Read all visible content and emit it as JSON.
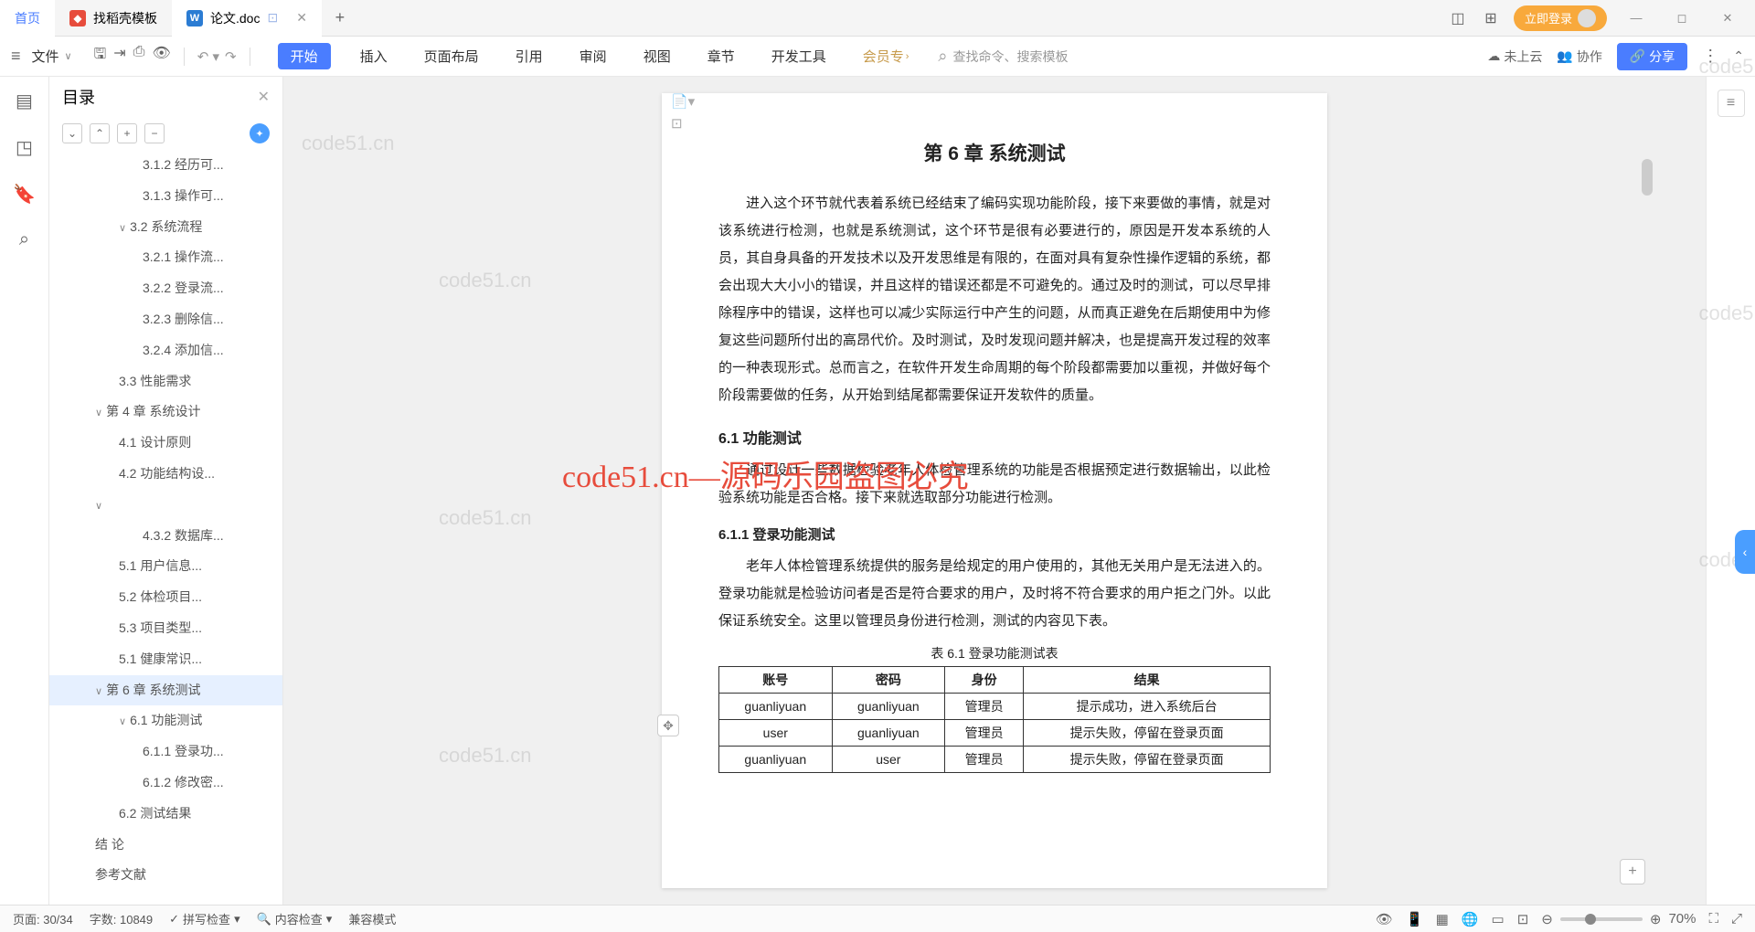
{
  "tabs": {
    "home": "首页",
    "template": "找稻壳模板",
    "doc": "论文.doc"
  },
  "login": "立即登录",
  "fileMenu": "文件",
  "ribbon": {
    "start": "开始",
    "insert": "插入",
    "layout": "页面布局",
    "reference": "引用",
    "review": "审阅",
    "view": "视图",
    "section": "章节",
    "devtools": "开发工具",
    "vip": "会员专"
  },
  "searchPlaceholder": "查找命令、搜索模板",
  "cloud": "未上云",
  "collab": "协作",
  "share": "分享",
  "outlineTitle": "目录",
  "outline": [
    {
      "t": "3.1.2 经历可...",
      "cls": "indent-4"
    },
    {
      "t": "3.1.3 操作可...",
      "cls": "indent-4"
    },
    {
      "t": "3.2 系统流程",
      "cls": "indent-3",
      "chev": "∨"
    },
    {
      "t": "3.2.1 操作流...",
      "cls": "indent-4"
    },
    {
      "t": "3.2.2 登录流...",
      "cls": "indent-4"
    },
    {
      "t": "3.2.3 删除信...",
      "cls": "indent-4"
    },
    {
      "t": "3.2.4 添加信...",
      "cls": "indent-4"
    },
    {
      "t": "3.3 性能需求",
      "cls": "indent-3"
    },
    {
      "t": "第 4 章  系统设计",
      "cls": "indent-2",
      "chev": "∨"
    },
    {
      "t": "4.1 设计原则",
      "cls": "indent-3"
    },
    {
      "t": "4.2 功能结构设...",
      "cls": "indent-3"
    },
    {
      "t": "",
      "cls": "indent-2",
      "chev": "∨"
    },
    {
      "t": "4.3.2 数据库...",
      "cls": "indent-4"
    },
    {
      "t": "5.1 用户信息...",
      "cls": "indent-3"
    },
    {
      "t": "5.2 体检项目...",
      "cls": "indent-3"
    },
    {
      "t": "5.3 项目类型...",
      "cls": "indent-3"
    },
    {
      "t": "5.1 健康常识...",
      "cls": "indent-3"
    },
    {
      "t": "第 6 章  系统测试",
      "cls": "indent-2",
      "chev": "∨",
      "sel": true
    },
    {
      "t": "6.1 功能测试",
      "cls": "indent-3",
      "chev": "∨"
    },
    {
      "t": "6.1.1 登录功...",
      "cls": "indent-4"
    },
    {
      "t": "6.1.2 修改密...",
      "cls": "indent-4"
    },
    {
      "t": "6.2 测试结果",
      "cls": "indent-3"
    },
    {
      "t": "结    论",
      "cls": "indent-2"
    },
    {
      "t": "参考文献",
      "cls": "indent-2"
    }
  ],
  "doc": {
    "h1": "第 6 章  系统测试",
    "p1": "进入这个环节就代表着系统已经结束了编码实现功能阶段，接下来要做的事情，就是对该系统进行检测，也就是系统测试，这个环节是很有必要进行的，原因是开发本系统的人员，其自身具备的开发技术以及开发思维是有限的，在面对具有复杂性操作逻辑的系统，都会出现大大小小的错误，并且这样的错误还都是不可避免的。通过及时的测试，可以尽早排除程序中的错误，这样也可以减少实际运行中产生的问题，从而真正避免在后期使用中为修复这些问题所付出的高昂代价。及时测试，及时发现问题并解决，也是提高开发过程的效率的一种表现形式。总而言之，在软件开发生命周期的每个阶段都需要加以重视，并做好每个阶段需要做的任务，从开始到结尾都需要保证开发软件的质量。",
    "h2": "6.1 功能测试",
    "p2": "通过设计一些数据检验老年人体检管理系统的功能是否根据预定进行数据输出，以此检验系统功能是否合格。接下来就选取部分功能进行检测。",
    "h3": "6.1.1 登录功能测试",
    "p3": "老年人体检管理系统提供的服务是给规定的用户使用的，其他无关用户是无法进入的。登录功能就是检验访问者是否是符合要求的用户，及时将不符合要求的用户拒之门外。以此保证系统安全。这里以管理员身份进行检测，测试的内容见下表。",
    "tableCaption": "表 6.1  登录功能测试表",
    "th": [
      "账号",
      "密码",
      "身份",
      "结果"
    ],
    "rows": [
      [
        "guanliyuan",
        "guanliyuan",
        "管理员",
        "提示成功，进入系统后台"
      ],
      [
        "user",
        "guanliyuan",
        "管理员",
        "提示失败，停留在登录页面"
      ],
      [
        "guanliyuan",
        "user",
        "管理员",
        "提示失败，停留在登录页面"
      ]
    ]
  },
  "watermark": "code51.cn",
  "redOverlay": "code51.cn—源码乐园盗图必究",
  "status": {
    "page": "页面: 30/34",
    "words": "字数: 10849",
    "spell": "拼写检查",
    "content": "内容检查",
    "compat": "兼容模式",
    "zoom": "70%"
  }
}
